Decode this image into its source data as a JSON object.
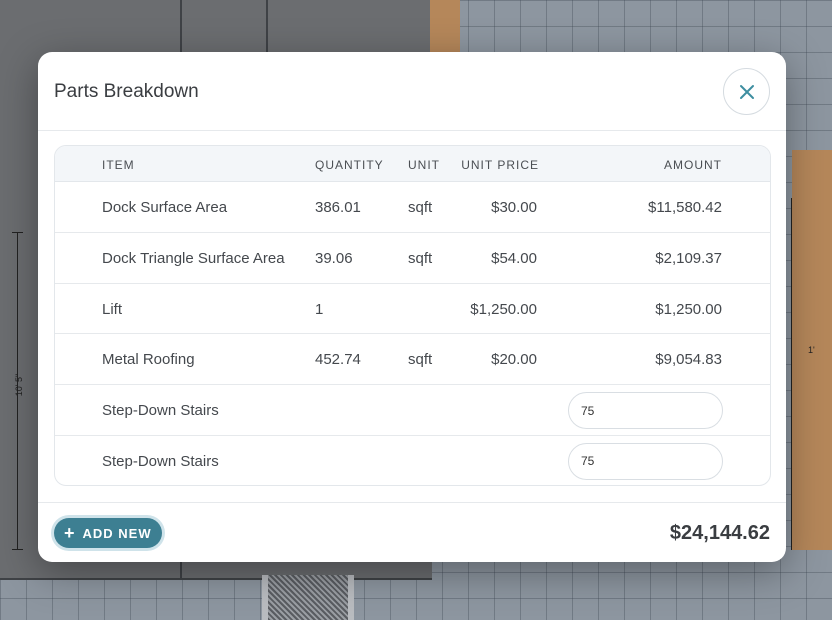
{
  "modal": {
    "title": "Parts Breakdown",
    "close_icon": "close-icon"
  },
  "table": {
    "headers": {
      "item": "ITEM",
      "quantity": "QUANTITY",
      "unit": "UNIT",
      "unit_price": "UNIT PRICE",
      "amount": "AMOUNT"
    },
    "rows": [
      {
        "item": "Dock Surface Area",
        "quantity": "386.01",
        "unit": "sqft",
        "unit_price": "$30.00",
        "amount": "$11,580.42"
      },
      {
        "item": "Dock Triangle Surface Area",
        "quantity": "39.06",
        "unit": "sqft",
        "unit_price": "$54.00",
        "amount": "$2,109.37"
      },
      {
        "item": "Lift",
        "quantity": "1",
        "unit": "",
        "unit_price": "$1,250.00",
        "amount": "$1,250.00"
      },
      {
        "item": "Metal Roofing",
        "quantity": "452.74",
        "unit": "sqft",
        "unit_price": "$20.00",
        "amount": "$9,054.83"
      },
      {
        "item": "Step-Down Stairs",
        "amount_input": "75"
      },
      {
        "item": "Step-Down Stairs",
        "amount_input": "75"
      }
    ]
  },
  "footer": {
    "add_icon": "+",
    "add_label": "ADD NEW",
    "total": "$24,144.62"
  },
  "background": {
    "dimension_left": "10' 5\"",
    "dimension_right": "1'"
  },
  "colors": {
    "accent": "#3d7f92",
    "close_icon": "#3d8ea0"
  }
}
